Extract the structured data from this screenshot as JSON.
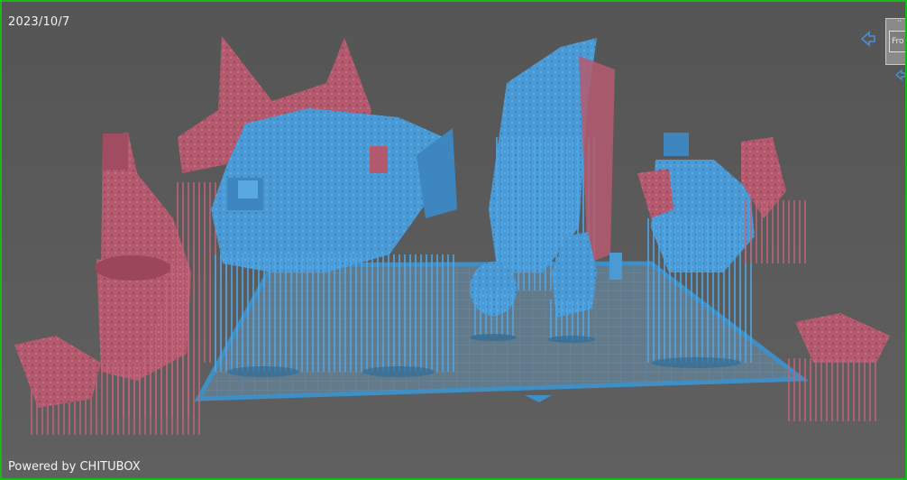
{
  "viewport": {
    "date_label": "2023/10/7",
    "powered_by": "Powered by CHITUBOX"
  },
  "view_cube": {
    "face_label": "Fro",
    "top_mark": "··"
  },
  "colors": {
    "border": "#18b818",
    "background": "#5a5a5a",
    "platform_grid": "#5f88a8",
    "platform_border": "#3f8ec4",
    "model_blue": "#4a9ad6",
    "model_pink": "#b45a6e",
    "nav_arrow": "#4a90d8"
  },
  "icons": [
    "rotate-left-arrow-icon",
    "view-cube-icon",
    "small-arrow-icon"
  ]
}
